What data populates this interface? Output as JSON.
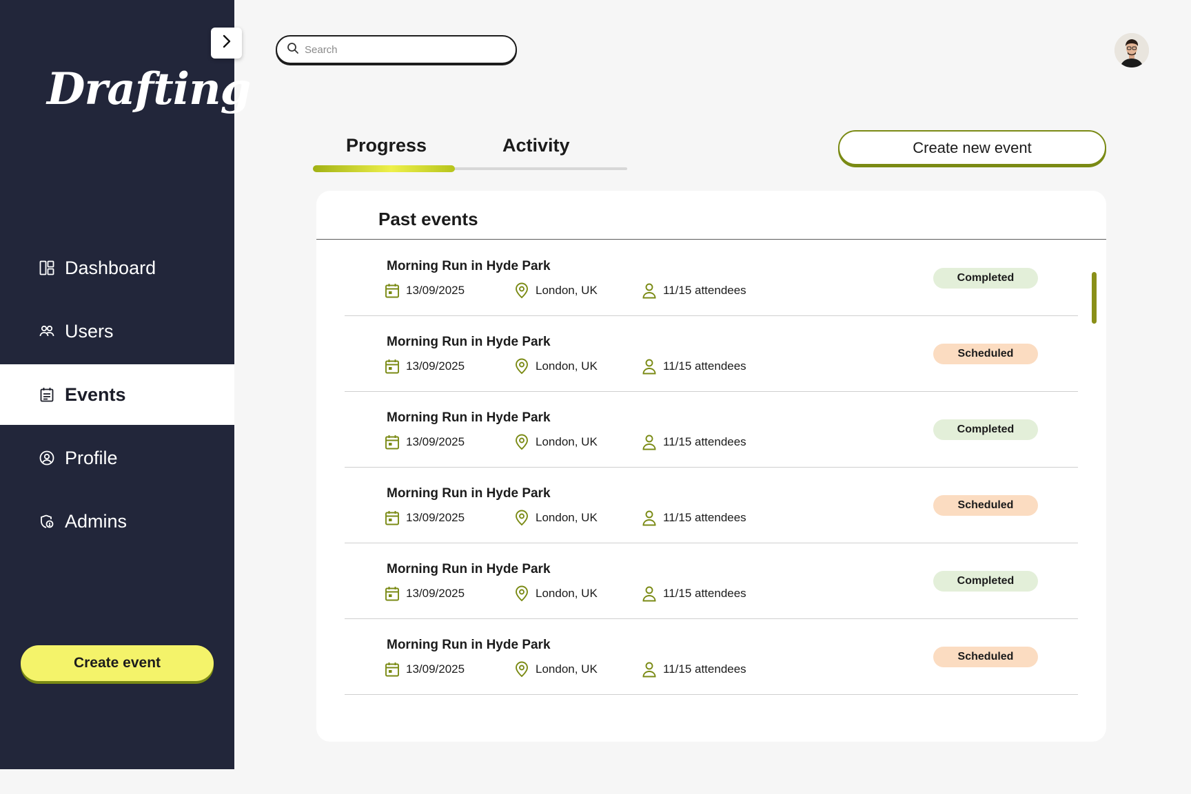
{
  "brand": {
    "logo_text": "Drafting"
  },
  "sidebar": {
    "items": [
      {
        "label": "Dashboard",
        "icon": "dashboard-icon",
        "active": false
      },
      {
        "label": "Users",
        "icon": "users-icon",
        "active": false
      },
      {
        "label": "Events",
        "icon": "calendar-list-icon",
        "active": true
      },
      {
        "label": "Profile",
        "icon": "user-circle-icon",
        "active": false
      },
      {
        "label": "Admins",
        "icon": "admin-shield-icon",
        "active": false
      }
    ],
    "create_event_label": "Create event"
  },
  "search": {
    "placeholder": "Search",
    "value": ""
  },
  "tabs": [
    {
      "label": "Progress",
      "active": true
    },
    {
      "label": "Activity",
      "active": false
    }
  ],
  "create_new_event_label": "Create new event",
  "past_events": {
    "title": "Past events",
    "rows": [
      {
        "title": "Morning Run in Hyde Park",
        "date": "13/09/2025",
        "location": "London, UK",
        "attendees": "11/15 attendees",
        "status": "Completed"
      },
      {
        "title": "Morning Run in Hyde Park",
        "date": "13/09/2025",
        "location": "London, UK",
        "attendees": "11/15 attendees",
        "status": "Scheduled"
      },
      {
        "title": "Morning Run in Hyde Park",
        "date": "13/09/2025",
        "location": "London, UK",
        "attendees": "11/15 attendees",
        "status": "Completed"
      },
      {
        "title": "Morning Run in Hyde Park",
        "date": "13/09/2025",
        "location": "London, UK",
        "attendees": "11/15 attendees",
        "status": "Scheduled"
      },
      {
        "title": "Morning Run in Hyde Park",
        "date": "13/09/2025",
        "location": "London, UK",
        "attendees": "11/15 attendees",
        "status": "Completed"
      },
      {
        "title": "Morning Run in Hyde Park",
        "date": "13/09/2025",
        "location": "London, UK",
        "attendees": "11/15 attendees",
        "status": "Scheduled"
      }
    ]
  },
  "colors": {
    "sidebar_bg": "#22263a",
    "accent_olive": "#7a8a14",
    "accent_yellow": "#f4f36a",
    "completed_bg": "#e3efd9",
    "scheduled_bg": "#fbdcc1"
  }
}
